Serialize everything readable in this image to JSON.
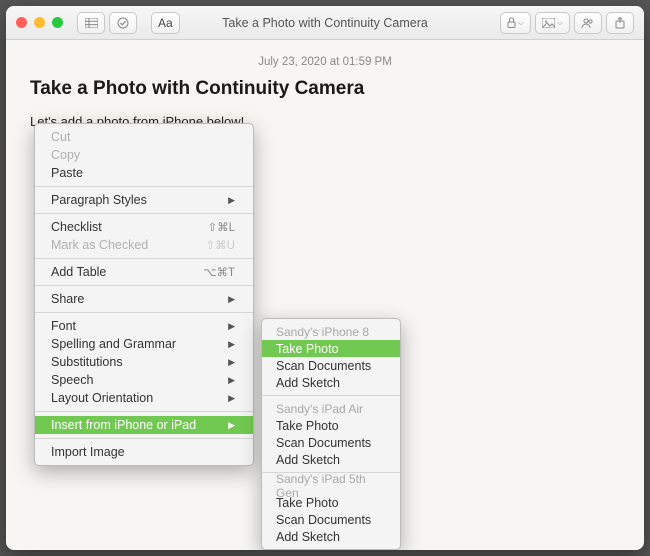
{
  "window": {
    "title": "Take a Photo with Continuity Camera"
  },
  "toolbar": {
    "format_label": "Aa"
  },
  "note": {
    "date": "July 23, 2020 at 01:59 PM",
    "heading": "Take a Photo with Continuity Camera",
    "body": "Let's add a photo from iPhone below!"
  },
  "menu": {
    "cut": "Cut",
    "copy": "Copy",
    "paste": "Paste",
    "paragraph_styles": "Paragraph Styles",
    "checklist": "Checklist",
    "checklist_sc": "⇧⌘L",
    "mark_checked": "Mark as Checked",
    "mark_checked_sc": "⇧⌘U",
    "add_table": "Add Table",
    "add_table_sc": "⌥⌘T",
    "share": "Share",
    "font": "Font",
    "spelling": "Spelling and Grammar",
    "subs": "Substitutions",
    "speech": "Speech",
    "layout": "Layout Orientation",
    "insert": "Insert from iPhone or iPad",
    "import_img": "Import Image"
  },
  "submenu": {
    "dev1": "Sandy's iPhone 8",
    "dev2": "Sandy's iPad Air",
    "dev3": "Sandy's iPad 5th Gen",
    "take_photo": "Take Photo",
    "scan_docs": "Scan Documents",
    "add_sketch": "Add Sketch"
  }
}
